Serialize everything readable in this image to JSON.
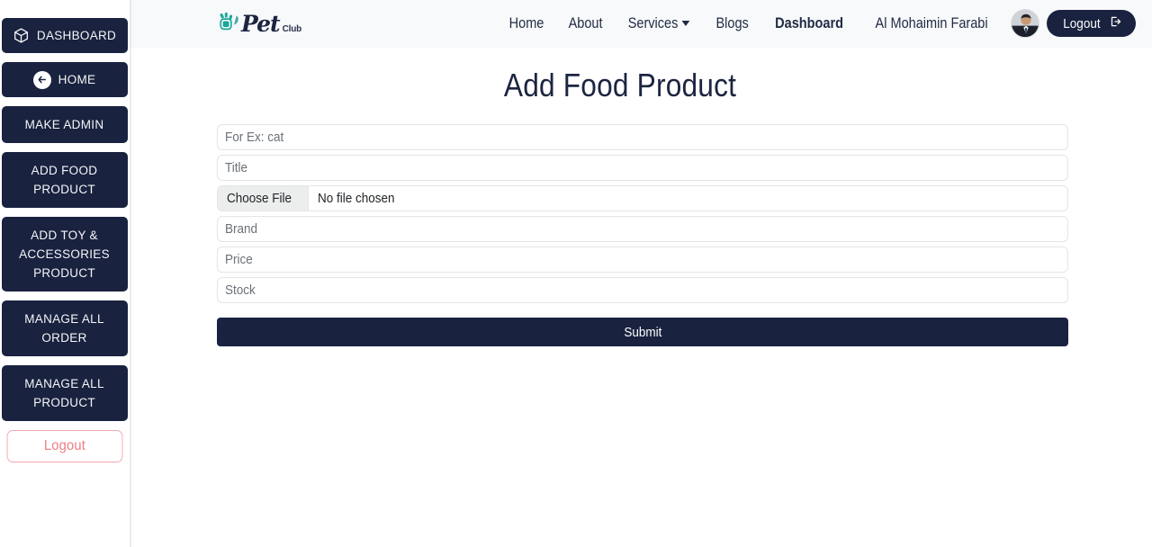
{
  "colors": {
    "navy": "#19223f",
    "teal": "#1aa89a",
    "logout_pink": "#f07c84",
    "header_bg": "#f8f9fa",
    "field_border": "#e4e5e7"
  },
  "sidebar": {
    "items": [
      {
        "label": "DASHBOARD",
        "icon": "cube-icon"
      },
      {
        "label": "HOME",
        "icon": "back-arrow-icon"
      },
      {
        "label": "MAKE ADMIN",
        "icon": ""
      },
      {
        "label": "ADD FOOD PRODUCT",
        "icon": ""
      },
      {
        "label": "ADD TOY & ACCESSORIES PRODUCT",
        "icon": ""
      },
      {
        "label": "MANAGE ALL ORDER",
        "icon": ""
      },
      {
        "label": "MANAGE ALL PRODUCT",
        "icon": ""
      }
    ],
    "logout_label": "Logout"
  },
  "header": {
    "brand": {
      "pet": "Pet",
      "club": "Club",
      "icon": "paw-leaf-icon"
    },
    "nav": [
      {
        "label": "Home",
        "active": false
      },
      {
        "label": "About",
        "active": false
      },
      {
        "label": "Services",
        "active": false,
        "icon": "chevron-down-icon"
      },
      {
        "label": "Blogs",
        "active": false
      },
      {
        "label": "Dashboard",
        "active": true
      }
    ],
    "user_name": "Al Mohaimin Farabi",
    "avatar_alt": "user-avatar",
    "logout_label": "Logout",
    "logout_icon": "sign-out-icon"
  },
  "main": {
    "title": "Add Food Product",
    "fields": [
      {
        "name": "category",
        "placeholder": "For Ex: cat",
        "value": ""
      },
      {
        "name": "title",
        "placeholder": "Title",
        "value": ""
      },
      {
        "name": "brand",
        "placeholder": "Brand",
        "value": ""
      },
      {
        "name": "price",
        "placeholder": "Price",
        "value": ""
      },
      {
        "name": "stock",
        "placeholder": "Stock",
        "value": ""
      }
    ],
    "file_input": {
      "button_label": "Choose File",
      "status_text": "No file chosen"
    },
    "submit_label": "Submit"
  }
}
